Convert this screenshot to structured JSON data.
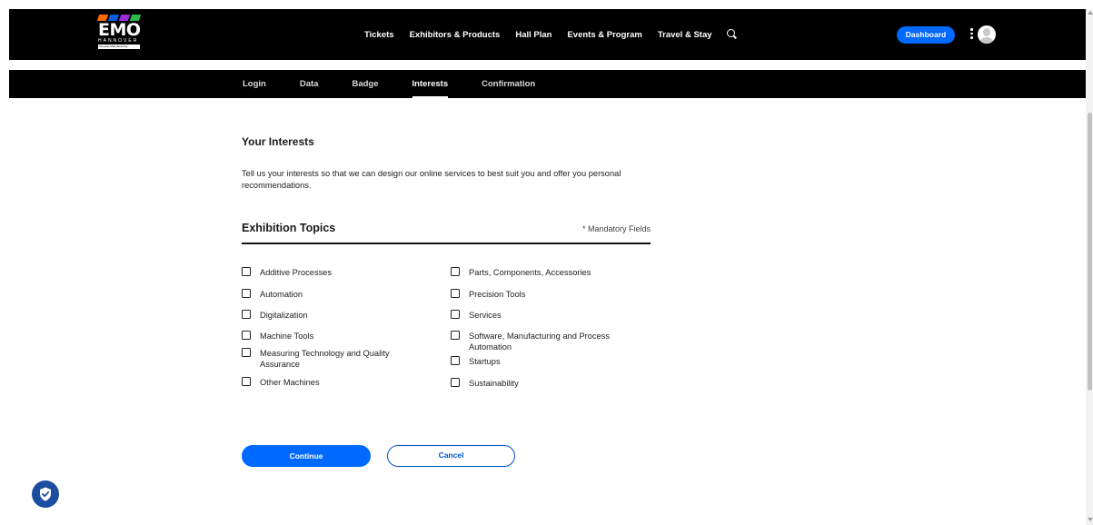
{
  "logo": {
    "brand": "EMO",
    "city": "HANNOVER",
    "tagline": "Innovate Manufacturing.",
    "stripe_colors": [
      "#ff6b00",
      "#0a5bd7",
      "#9b2dd6",
      "#2db84b"
    ]
  },
  "header": {
    "nav": [
      "Tickets",
      "Exhibitors & Products",
      "Hall Plan",
      "Events & Program",
      "Travel & Stay"
    ],
    "search_icon": "search-icon",
    "dashboard_label": "Dashboard",
    "menu_icon": "kebab-menu-icon",
    "avatar_icon": "user-avatar-icon"
  },
  "steps": {
    "items": [
      "Login",
      "Data",
      "Badge",
      "Interests",
      "Confirmation"
    ],
    "active": "Interests"
  },
  "main": {
    "heading": "Your Interests",
    "intro": "Tell us your interests so that we can design our online services to best suit you and offer you personal recommendations.",
    "section_title": "Exhibition Topics",
    "mandatory_note": "* Mandatory Fields",
    "topics_left": [
      "Additive Processes",
      "Automation",
      "Digitalization",
      "Machine Tools",
      "Measuring Technology and Quality Assurance",
      "Other Machines"
    ],
    "topics_right": [
      "Parts, Components, Accessories",
      "Precision Tools",
      "Services",
      "Software, Manufacturing and Process Automation",
      "Startups",
      "Sustainability"
    ],
    "continue_label": "Continue",
    "cancel_label": "Cancel"
  },
  "colors": {
    "primary": "#0069ff",
    "header_bg": "#000000",
    "privacy_badge": "#1c4ea0"
  },
  "privacy_icon": "shield-check-icon"
}
